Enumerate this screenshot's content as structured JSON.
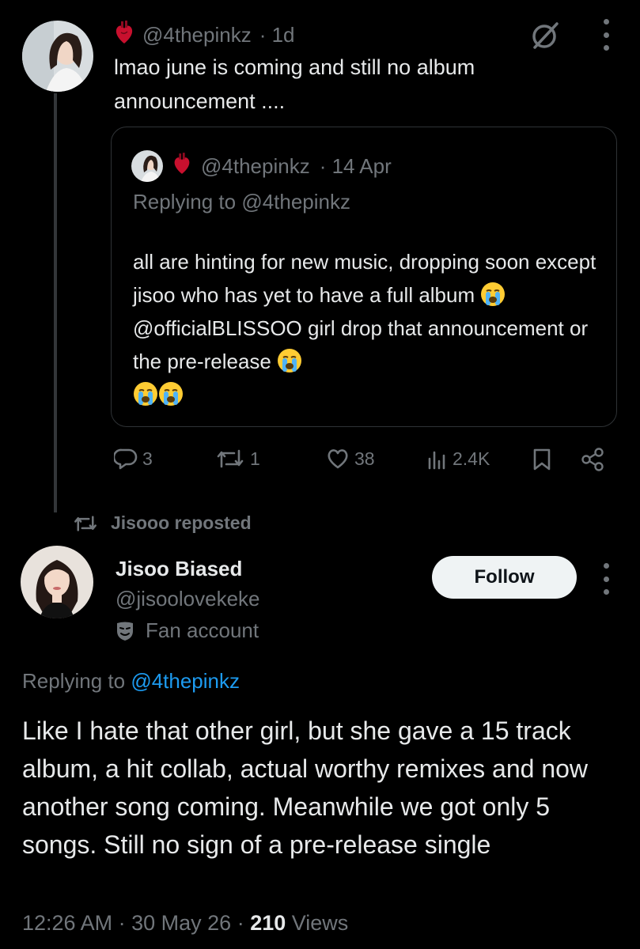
{
  "parent_tweet": {
    "handle": "@4thepinkz",
    "time": "· 1d",
    "text": "lmao june is coming and still no album announcement ....",
    "quote": {
      "handle": "@4thepinkz",
      "time": "· 14 Apr",
      "replying_prefix": "Replying to",
      "replying_handle": "@4thepinkz",
      "text_part1": "all are hinting for new music, dropping soon except jisoo who has yet to have a full album",
      "text_part2": "@officialBLISSOO girl drop that announcement or the pre-release",
      "emoji": "crying-face"
    },
    "actions": {
      "replies": "3",
      "reposts": "1",
      "likes": "38",
      "views": "2.4K"
    }
  },
  "repost_banner": "Jisooo reposted",
  "main_tweet": {
    "name": "Jisoo Biased",
    "handle": "@jisoolovekeke",
    "account_label": "Fan account",
    "follow_label": "Follow",
    "replying_prefix": "Replying to",
    "replying_handle": "@4thepinkz",
    "text": "Like I hate that other girl, but she gave a 15 track album, a hit collab, actual worthy remixes and now another song coming. Meanwhile we got only 5 songs. Still no sign of a pre-release single",
    "time": "12:26 AM",
    "date": "30 May 26",
    "views_count": "210",
    "views_label": "Views"
  },
  "colors": {
    "background": "#000000",
    "text": "#e7e9ea",
    "muted": "#71767b",
    "link": "#1d9bf0",
    "heart_emoji": "#c8102e"
  }
}
